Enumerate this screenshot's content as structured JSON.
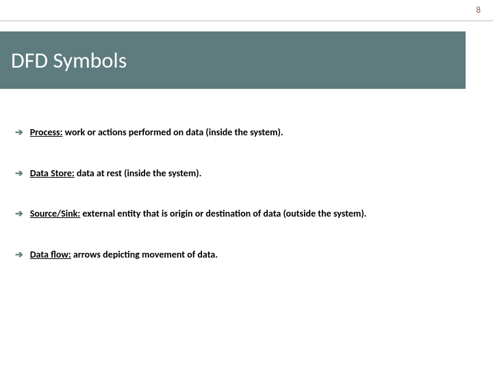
{
  "page_number": "8",
  "title": "DFD Symbols",
  "bullets": [
    {
      "term": "Process:",
      "desc": " work or actions performed on data (inside the system)."
    },
    {
      "term": "Data Store:",
      "desc": " data at rest (inside the system)."
    },
    {
      "term": "Source/Sink:",
      "desc": " external entity that is origin or destination of data (outside the system)."
    },
    {
      "term": "Data flow:",
      "desc": " arrows depicting movement of data."
    }
  ]
}
